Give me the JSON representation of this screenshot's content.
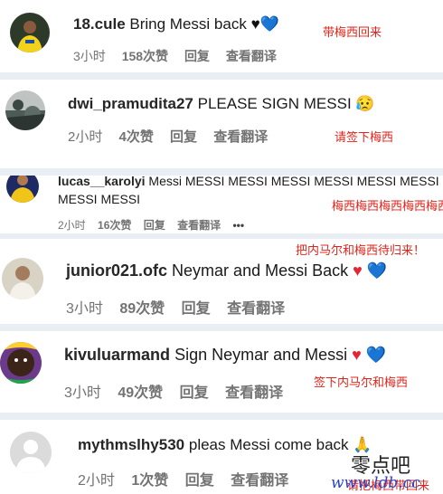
{
  "comments": [
    {
      "username": "18.cule",
      "text": "Bring Messi back",
      "emojis": [
        "♥",
        "💙"
      ],
      "time": "3小时",
      "likes": "158次赞",
      "reply": "回复",
      "translate": "查看翻译",
      "note": "带梅西回来"
    },
    {
      "username": "dwi_pramudita27",
      "text": "PLEASE SIGN MESSI",
      "emojis": [
        "😥"
      ],
      "time": "2小时",
      "likes": "4次赞",
      "reply": "回复",
      "translate": "查看翻译",
      "note": "请签下梅西"
    },
    {
      "username": "lucas__karolyi",
      "text": "Messi MESSI MESSI MESSI MESSI MESSI MESSI",
      "text_line2": "MESSI MESSI",
      "time": "2小时",
      "likes": "16次赞",
      "reply": "回复",
      "translate": "查看翻译",
      "more": "•••",
      "note": "梅西梅西梅西梅西梅西"
    },
    {
      "username": "junior021.ofc",
      "text": "Neymar and Messi Back",
      "emojis": [
        "♥",
        "💙"
      ],
      "time": "3小时",
      "likes": "89次赞",
      "reply": "回复",
      "translate": "查看翻译",
      "note": "把内马尔和梅西待归来！"
    },
    {
      "username": "kivuluarmand",
      "text": "Sign Neymar and Messi",
      "emojis": [
        "♥",
        "💙"
      ],
      "time": "3小时",
      "likes": "49次赞",
      "reply": "回复",
      "translate": "查看翻译",
      "note": "签下内马尔和梅西"
    },
    {
      "username": "mythmslhy530",
      "text": "pleas Messi come back",
      "emojis": [
        "🙏"
      ],
      "time": "2小时",
      "likes": "1次赞",
      "reply": "回复",
      "translate": "查看翻译",
      "note": "请把梅西带回来"
    }
  ],
  "watermark": {
    "title": "零点吧",
    "url": "www.ldb.cc"
  },
  "colors": {
    "note": "#e0241b",
    "heart_red": "#e32636",
    "heart_blue": "#1e73d8",
    "meta": "#737373",
    "separator": "#e9eef4"
  }
}
